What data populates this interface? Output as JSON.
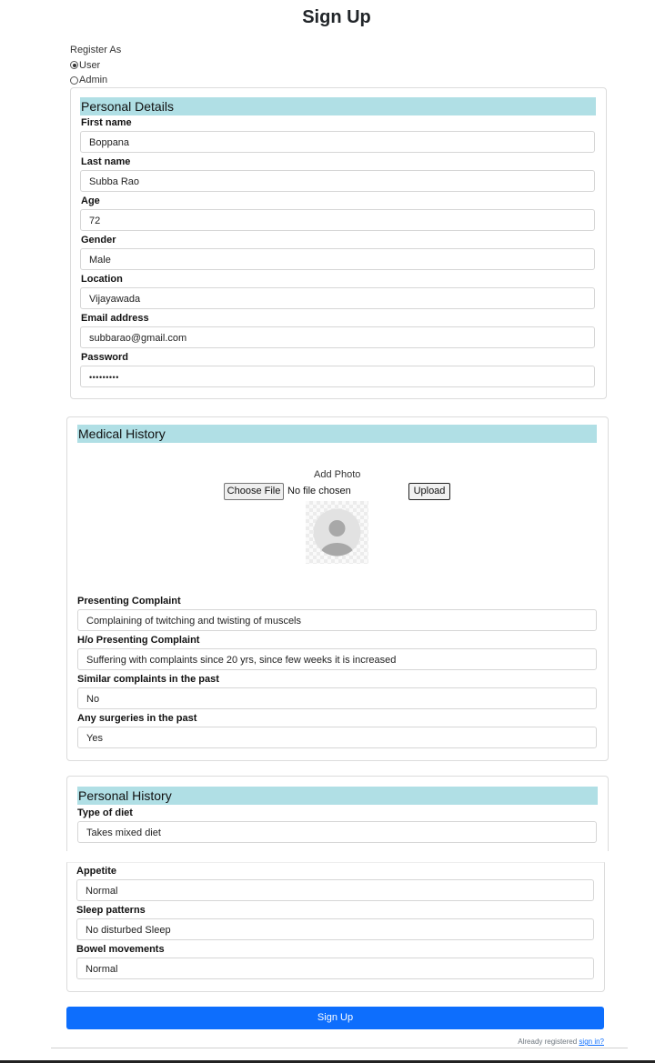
{
  "page": {
    "title": "Sign Up"
  },
  "register": {
    "label": "Register As",
    "options": [
      {
        "label": "User",
        "selected": true
      },
      {
        "label": "Admin",
        "selected": false
      }
    ]
  },
  "personal_details": {
    "heading": "Personal Details",
    "fields": [
      {
        "label": "First name",
        "value": "Boppana"
      },
      {
        "label": "Last name",
        "value": "Subba Rao"
      },
      {
        "label": "Age",
        "value": "72"
      },
      {
        "label": "Gender",
        "value": "Male"
      },
      {
        "label": "Location",
        "value": "Vijayawada"
      },
      {
        "label": "Email address",
        "value": "subbarao@gmail.com"
      },
      {
        "label": "Password",
        "value": "•••••••••"
      }
    ]
  },
  "medical_history": {
    "heading": "Medical History",
    "photo_label": "Add Photo",
    "choose_file": "Choose File",
    "no_file": "No file chosen",
    "upload": "Upload",
    "fields": [
      {
        "label": "Presenting Complaint",
        "value": "Complaining of twitching and  twisting of muscels"
      },
      {
        "label": "H/o Presenting Complaint",
        "value": "Suffering with complaints since  20 yrs, since few weeks it is  increased"
      },
      {
        "label": "Similar complaints in the past",
        "value": "No"
      },
      {
        "label": "Any surgeries in the past",
        "value": "Yes"
      }
    ]
  },
  "personal_history": {
    "heading": "Personal History",
    "fields": [
      {
        "label": "Type of diet",
        "value": "Takes mixed diet"
      },
      {
        "label": "Appetite",
        "value": "Normal"
      },
      {
        "label": "Sleep patterns",
        "value": "No disturbed Sleep"
      },
      {
        "label": "Bowel movements",
        "value": "Normal"
      }
    ]
  },
  "footer": {
    "submit": "Sign Up",
    "already": "Already registered ",
    "signin_link": "sign in?"
  },
  "colors": {
    "section_header": "#b0dfe5",
    "primary": "#0d6efd"
  }
}
